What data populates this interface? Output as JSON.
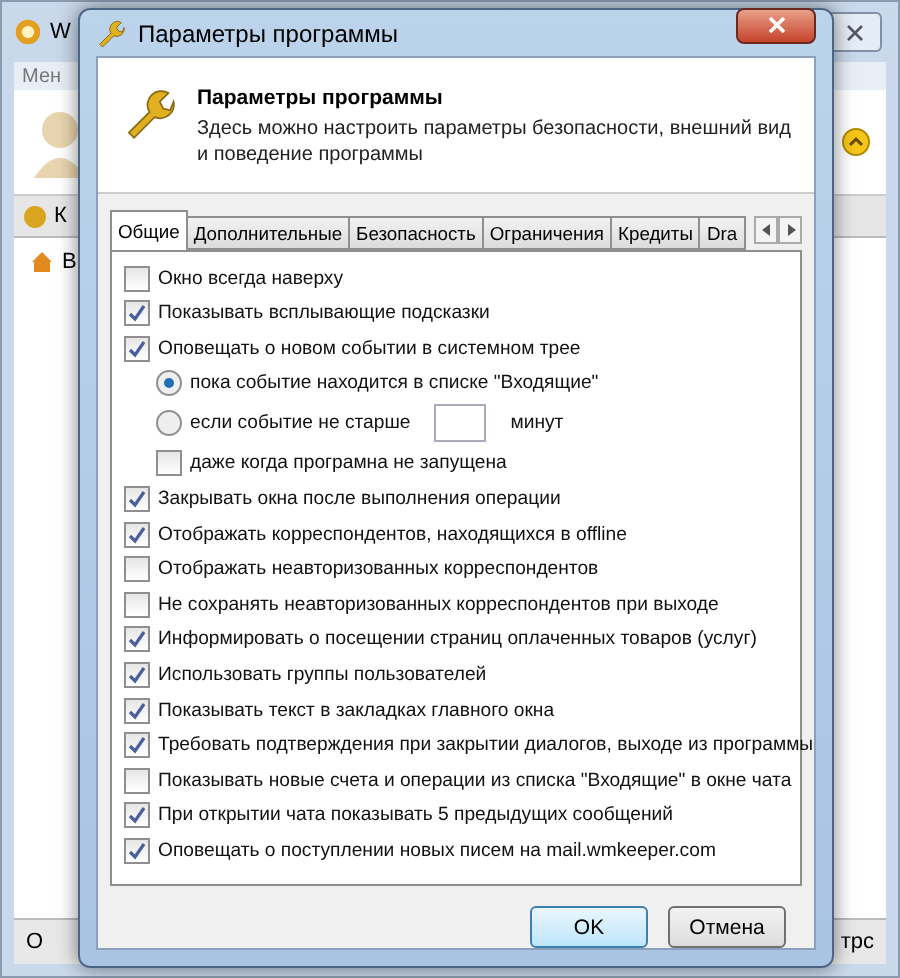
{
  "background_window": {
    "title": "W",
    "menu": "Мен",
    "tab": "К",
    "list_item": "В",
    "status_left": "О",
    "status_right": "трс"
  },
  "dialog": {
    "title": "Параметры программы",
    "heading": "Параметры программы",
    "description": "Здесь можно настроить параметры безопасности, внешний вид и поведение программы",
    "tabs": [
      {
        "label": "Общие",
        "selected": true
      },
      {
        "label": "Дополнительные",
        "selected": false
      },
      {
        "label": "Безопасность",
        "selected": false
      },
      {
        "label": "Ограничения",
        "selected": false
      },
      {
        "label": "Кредиты",
        "selected": false
      },
      {
        "label": "Dra",
        "selected": false
      }
    ],
    "options": [
      {
        "kind": "checkbox",
        "label": "Окно всегда наверху",
        "checked": false
      },
      {
        "kind": "checkbox",
        "label": "Показывать всплывающие подсказки",
        "checked": true
      },
      {
        "kind": "checkbox",
        "label": "Оповещать о новом событии в системном трее",
        "checked": true,
        "children": [
          {
            "kind": "radio",
            "label": "пока событие находится в списке \"Входящие\"",
            "selected": true
          },
          {
            "kind": "radio",
            "label": "если событие не старше",
            "selected": false,
            "suffix": "минут"
          },
          {
            "kind": "checkbox",
            "label": "даже когда програмна не запущена",
            "checked": false
          }
        ]
      },
      {
        "kind": "checkbox",
        "label": "Закрывать окна после выполнения операции",
        "checked": true
      },
      {
        "kind": "checkbox",
        "label": "Отображать корреспондентов, находящихся в offline",
        "checked": true
      },
      {
        "kind": "checkbox",
        "label": "Отображать неавторизованных корреспондентов",
        "checked": false
      },
      {
        "kind": "checkbox",
        "label": "Не сохранять неавторизованных корреспондентов при выходе",
        "checked": false
      },
      {
        "kind": "checkbox",
        "label": "Информировать о посещении страниц оплаченных товаров (услуг)",
        "checked": true
      },
      {
        "kind": "checkbox",
        "label": "Использовать группы пользователей",
        "checked": true
      },
      {
        "kind": "checkbox",
        "label": "Показывать текст в закладках главного окна",
        "checked": true
      },
      {
        "kind": "checkbox",
        "label": "Требовать подтверждения при закрытии диалогов, выходе из программы",
        "checked": true
      },
      {
        "kind": "checkbox",
        "label": "Показывать новые счета и операции из списка \"Входящие\" в окне чата",
        "checked": false
      },
      {
        "kind": "checkbox",
        "label": "При открытии чата показывать 5 предыдущих сообщений",
        "checked": true
      },
      {
        "kind": "checkbox",
        "label": "Оповещать о поступлении новых писем на mail.wmkeeper.com",
        "checked": true
      }
    ],
    "buttons": [
      {
        "label": "OK",
        "default": true
      },
      {
        "label": "Отмена",
        "default": false
      }
    ]
  }
}
